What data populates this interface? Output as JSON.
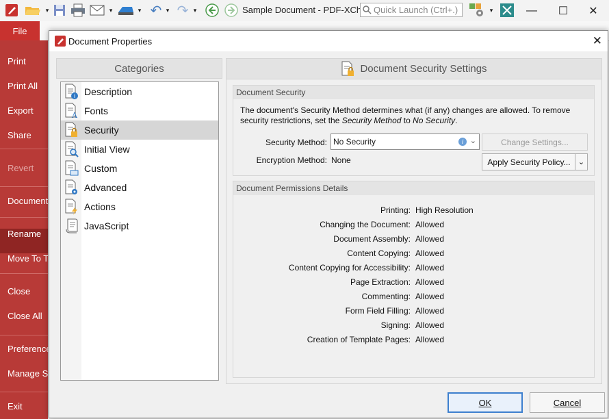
{
  "app": {
    "window_title": "Sample Document - PDF-XCha...",
    "quick_launch_placeholder": "Quick Launch (Ctrl+.)"
  },
  "ribbon": {
    "file_label": "File"
  },
  "backstage": {
    "items": [
      {
        "label": "Print"
      },
      {
        "label": "Print All"
      },
      {
        "label": "Export"
      },
      {
        "label": "Share"
      },
      {
        "label": "Revert"
      },
      {
        "label": "Document"
      },
      {
        "label": "Rename"
      },
      {
        "label": "Move To Tra"
      },
      {
        "label": "Close"
      },
      {
        "label": "Close All"
      },
      {
        "label": "Preferences"
      },
      {
        "label": "Manage Se"
      },
      {
        "label": "Exit"
      }
    ]
  },
  "dialog": {
    "title": "Document Properties",
    "categories_header": "Categories",
    "categories": [
      {
        "label": "Description"
      },
      {
        "label": "Fonts"
      },
      {
        "label": "Security"
      },
      {
        "label": "Initial View"
      },
      {
        "label": "Custom"
      },
      {
        "label": "Advanced"
      },
      {
        "label": "Actions"
      },
      {
        "label": "JavaScript"
      }
    ],
    "selected_category": "Security",
    "panel_header": "Document Security Settings",
    "security": {
      "group_title": "Document Security",
      "desc_1": "The document's Security Method determines what (if any) changes are allowed. To remove security restrictions, set the ",
      "desc_em1": "Security Method",
      "desc_mid": " to ",
      "desc_em2": "No Security",
      "desc_end": ".",
      "method_label": "Security Method:",
      "method_value": "No Security",
      "change_settings": "Change Settings...",
      "encryption_label": "Encryption Method:",
      "encryption_value": "None",
      "apply_policy": "Apply Security Policy..."
    },
    "permissions": {
      "group_title": "Document Permissions Details",
      "rows": [
        {
          "label": "Printing:",
          "value": "High Resolution"
        },
        {
          "label": "Changing the Document:",
          "value": "Allowed"
        },
        {
          "label": "Document Assembly:",
          "value": "Allowed"
        },
        {
          "label": "Content Copying:",
          "value": "Allowed"
        },
        {
          "label": "Content Copying for Accessibility:",
          "value": "Allowed"
        },
        {
          "label": "Page Extraction:",
          "value": "Allowed"
        },
        {
          "label": "Commenting:",
          "value": "Allowed"
        },
        {
          "label": "Form Field Filling:",
          "value": "Allowed"
        },
        {
          "label": "Signing:",
          "value": "Allowed"
        },
        {
          "label": "Creation of Template Pages:",
          "value": "Allowed"
        }
      ]
    },
    "ok": "OK",
    "cancel": "Cancel"
  },
  "colors": {
    "backstage": "#b83a37",
    "file_tab": "#c8322f",
    "accent": "#3c7fce"
  }
}
